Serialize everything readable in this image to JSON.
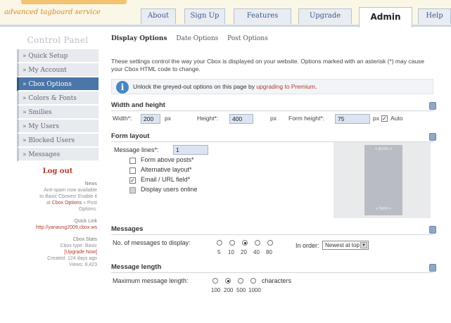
{
  "header": {
    "tagline": "advanced tagboard service",
    "tabs": [
      "About",
      "Sign Up",
      "Features",
      "Upgrade",
      "Admin",
      "Help"
    ],
    "active_tab": "Admin"
  },
  "sidebar": {
    "title": "Control Panel",
    "items": [
      "» Quick Setup",
      "» My Account",
      "» Cbox Options",
      "» Colors & Fonts",
      "» Smilies",
      "» My Users",
      "» Blocked Users",
      "» Messages"
    ],
    "logout": "Log out",
    "news": {
      "head": "News",
      "line1": "Anti-spam now available",
      "line2": "to Basic Cboxes! Enable it",
      "line3_pre": "at ",
      "line3_link": "Cbox Options",
      "line3_post": " » Post",
      "line4": "Options."
    },
    "quick_link": {
      "head": "Quick Link",
      "url": "http://yanaung2009.cbox.ws"
    },
    "stats": {
      "head": "Cbox Stats",
      "type": "Cbox type: Basic",
      "upgrade": "[Upgrade Now]",
      "created": "Created: 124 days ago",
      "views": "Views: 9,423"
    }
  },
  "main": {
    "subtabs": [
      "Display Options",
      "Date Options",
      "Post Options"
    ],
    "intro": "These settings control the way your Cbox is displayed on your website. Options marked with an asterisk (*) may cause your Cbox HTML code to change.",
    "notice_pre": "Unlock the greyed-out options on this page by ",
    "notice_link": "upgrading to Premium",
    "notice_post": ".",
    "wh": {
      "title": "Width and height",
      "width_label": "Width*:",
      "width_value": "200",
      "px1": "px",
      "height_label": "Height*:",
      "height_value": "400",
      "px2": "px",
      "form_height_label": "Form height*:",
      "form_height_value": "75",
      "px3": "px",
      "auto_label": "Auto"
    },
    "form_layout": {
      "title": "Form layout",
      "lines_label": "Message lines*:",
      "lines_value": "1",
      "opt1": "Form above posts*",
      "opt2": "Alternative layout*",
      "opt3": "Email / URL field*",
      "opt4": "Display users online",
      "preview_top": "« posts »",
      "preview_bottom": "« form »"
    },
    "messages": {
      "title": "Messages",
      "label": "No. of messages to display:",
      "options": [
        "5",
        "10",
        "20",
        "40",
        "80"
      ],
      "selected": "20",
      "order_label": "In order:",
      "order_value": "Newest at top"
    },
    "length": {
      "title": "Message length",
      "label": "Maximum message length:",
      "options": [
        "100",
        "200",
        "500",
        "1000"
      ],
      "selected": "200",
      "suffix": "characters"
    }
  }
}
